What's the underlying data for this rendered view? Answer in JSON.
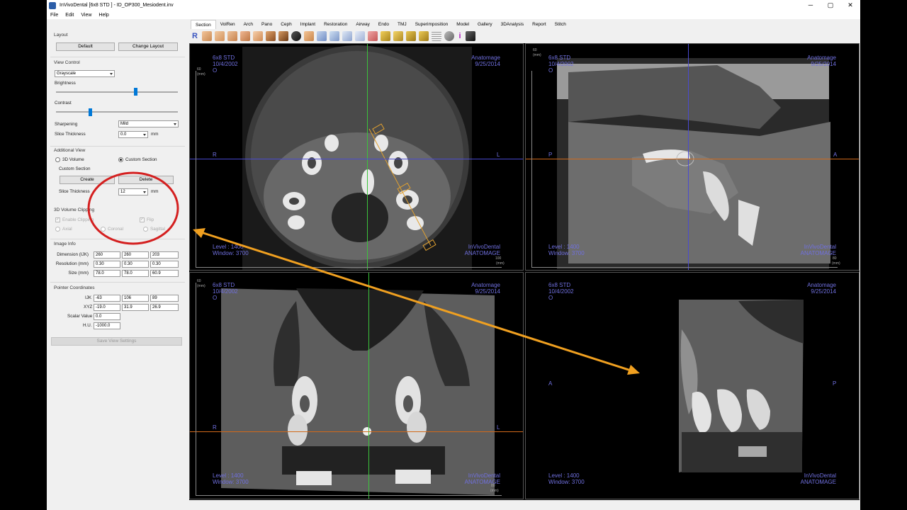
{
  "window": {
    "title": "InVivoDental [6x8 STD ] - ID_OP300_Mesiodent.inv",
    "controls": [
      "─",
      "▢",
      "✕"
    ]
  },
  "menu": [
    "File",
    "Edit",
    "View",
    "Help"
  ],
  "tabs": [
    "Section",
    "VolRen",
    "Arch",
    "Pano",
    "Ceph",
    "Implant",
    "Restoration",
    "Airway",
    "Endo",
    "TMJ",
    "Superimposition",
    "Model",
    "Gallery",
    "3DAnalysis",
    "Report",
    "Stitch"
  ],
  "active_tab": "Section",
  "toolbar": {
    "first_glyph": "R",
    "info_glyph": "i"
  },
  "left": {
    "layout": {
      "title": "Layout",
      "default_btn": "Default",
      "change_btn": "Change Layout"
    },
    "view_control": {
      "title": "View Control",
      "colormap": "Grayscale",
      "brightness_label": "Brightness",
      "brightness_level": 0.65,
      "contrast_label": "Contrast",
      "contrast_level": 0.28,
      "sharpening_label": "Sharpening",
      "sharpening_value": "Mild",
      "slice_label": "Slice Thickness",
      "slice_value": "0.0",
      "unit": "mm"
    },
    "additional_view": {
      "title": "Additional View",
      "opt_3d": "3D Volume",
      "opt_custom": "Custom Section",
      "custom_section_label": "Custom Section",
      "create_btn": "Create",
      "delete_btn": "Delete",
      "slice_label": "Slice Thickness",
      "slice_value": "12",
      "unit": "mm"
    },
    "clipping": {
      "title": "3D Volume Clipping",
      "enable": "Enable Clipping",
      "flip": "Flip",
      "axial": "Axial",
      "coronal": "Coronal",
      "sagittal": "Sagittal"
    },
    "image_info": {
      "title": "Image Info",
      "rows": [
        {
          "label": "Dimension (IJK)",
          "v": [
            "260",
            "260",
            "203"
          ]
        },
        {
          "label": "Resolution (mm)",
          "v": [
            "0.30",
            "0.30",
            "0.30"
          ]
        },
        {
          "label": "Size (mm)",
          "v": [
            "78.0",
            "78.0",
            "60.9"
          ]
        }
      ]
    },
    "pointer": {
      "title": "Pointer Coordinates",
      "ijk_label": "IJK",
      "ijk": [
        "-63",
        "106",
        "89"
      ],
      "xyz_label": "XYZ",
      "xyz": [
        "-19.0",
        "31.9",
        "26.9"
      ],
      "scalar_label": "Scalar Value",
      "scalar": "0.0",
      "hu_label": "H.U.",
      "hu": "-1000.0"
    },
    "save_btn": "Save View Settings"
  },
  "viewports": {
    "axial": {
      "tl": [
        "6x8 STD",
        "10/4/2002",
        "O"
      ],
      "tr": [
        "Anatomage",
        "9/25/2014"
      ],
      "bl": [
        "Level : 1400",
        "Window: 3700"
      ],
      "br": [
        "InVivoDental",
        "ANATOMAGE"
      ],
      "left_dir": "R",
      "right_dir": "L",
      "ruler_top": "60",
      "ruler_unit": "(mm)",
      "ruler_bottom_right": "100",
      "ruler_bottom_unit": "(mm)"
    },
    "sagittal": {
      "tl": [
        "6x8 STD",
        "10/4/2002",
        "O"
      ],
      "tr": [
        "Anatomage",
        "9/25/2014"
      ],
      "bl": [
        "Level : 1400",
        "Window: 3700"
      ],
      "br": [
        "InVivoDental",
        "ANATOMAGE"
      ],
      "left_dir": "P",
      "right_dir": "A",
      "ruler_top": "60",
      "ruler_unit": "(mm)",
      "ruler_bottom_right": "80",
      "ruler_bottom_unit": "(mm)"
    },
    "coronal": {
      "tl": [
        "6x8 STD",
        "10/4/2002",
        "O"
      ],
      "tr": [
        "Anatomage",
        "9/25/2014"
      ],
      "bl": [
        "Level : 1400",
        "Window: 3700"
      ],
      "br": [
        "InVivoDental",
        "ANATOMAGE"
      ],
      "left_dir": "R",
      "right_dir": "L",
      "ruler_top": "60",
      "ruler_unit": "(mm)",
      "ruler_bottom_right": "80",
      "ruler_bottom_unit": "(mm)"
    },
    "custom": {
      "tl": [
        "6x8 STD",
        "10/4/2002",
        "O"
      ],
      "tr": [
        "Anatomage",
        "9/25/2014"
      ],
      "bl": [
        "Level : 1400",
        "Window: 3700"
      ],
      "br": [
        "InVivoDental",
        "ANATOMAGE"
      ],
      "left_dir": "A",
      "right_dir": "P"
    }
  },
  "colors": {
    "overlay_text": "#7070e0",
    "annotation_circle": "#d42020",
    "annotation_arrow": "#f0a020",
    "crosshair_green": "#3cc43c",
    "crosshair_blue": "#4a4ad0",
    "crosshair_orange": "#d26a1a",
    "slider_thumb": "#0078d7"
  }
}
